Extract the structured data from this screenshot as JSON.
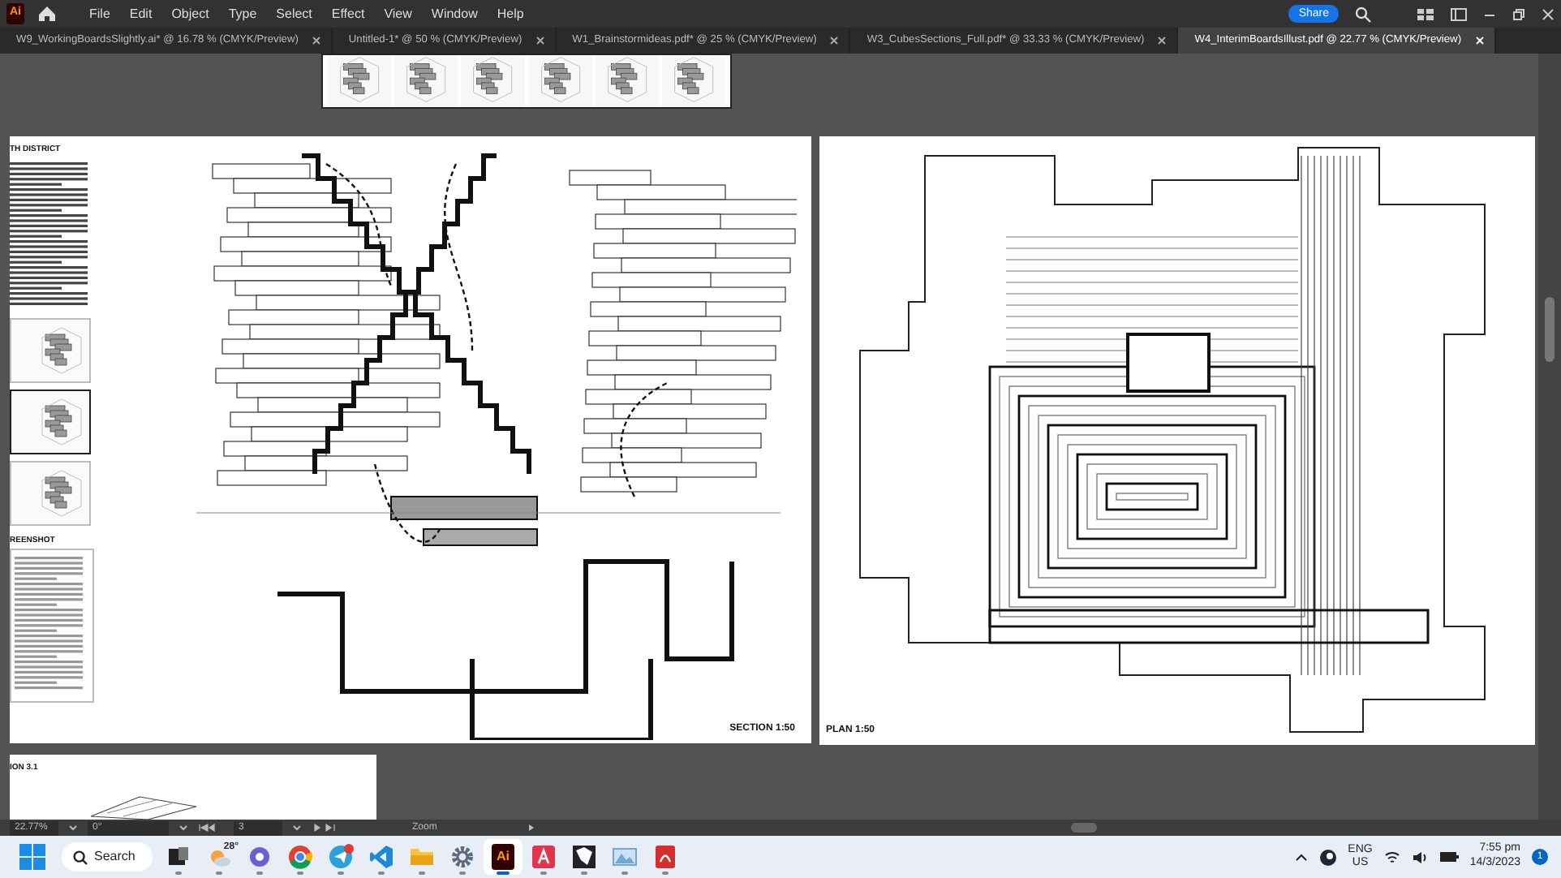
{
  "app_logo": "Ai",
  "menu": [
    "File",
    "Edit",
    "Object",
    "Type",
    "Select",
    "Effect",
    "View",
    "Window",
    "Help"
  ],
  "share_button": "Share",
  "tabs": [
    {
      "label": "W9_WorkingBoardsSlightly.ai* @ 16.78 % (CMYK/Preview)",
      "selected": false
    },
    {
      "label": "Untitled-1* @ 50 % (CMYK/Preview)",
      "selected": false
    },
    {
      "label": "W1_Brainstormideas.pdf* @ 25 % (CMYK/Preview)",
      "selected": false
    },
    {
      "label": "W3_CubesSections_Full.pdf* @ 33.33 % (CMYK/Preview)",
      "selected": false
    },
    {
      "label": "W4_InterimBoardsIllust.pdf @ 22.77 % (CMYK/Preview)",
      "selected": true
    }
  ],
  "artboards": {
    "left_headings": [
      "TH DISTRICT",
      "REENSHOT"
    ],
    "section_label": "SECTION 1:50",
    "plan_label": "PLAN 1:50",
    "bottom_heading": "ION 3.1"
  },
  "status_bar": {
    "zoom": "22.77%",
    "rotation": "0°",
    "artboard": "3",
    "tool": "Zoom"
  },
  "taskbar": {
    "search": "Search",
    "weather": "28°",
    "apps": [
      {
        "kind": "taskview",
        "active": false
      },
      {
        "kind": "weather",
        "active": false
      },
      {
        "kind": "chat",
        "active": false
      },
      {
        "kind": "chrome",
        "active": false
      },
      {
        "kind": "telegram",
        "active": false
      },
      {
        "kind": "vscode",
        "active": false
      },
      {
        "kind": "files",
        "active": false
      },
      {
        "kind": "settings",
        "active": false
      },
      {
        "kind": "illustrator",
        "active": true,
        "label": "Ai"
      },
      {
        "kind": "acrobat",
        "active": false
      },
      {
        "kind": "inkscape",
        "active": false
      },
      {
        "kind": "photos",
        "active": false
      },
      {
        "kind": "pdf",
        "active": false
      }
    ],
    "language": "ENG",
    "region": "US",
    "time": "7:55 pm",
    "date": "14/3/2023",
    "notifications": "1"
  }
}
